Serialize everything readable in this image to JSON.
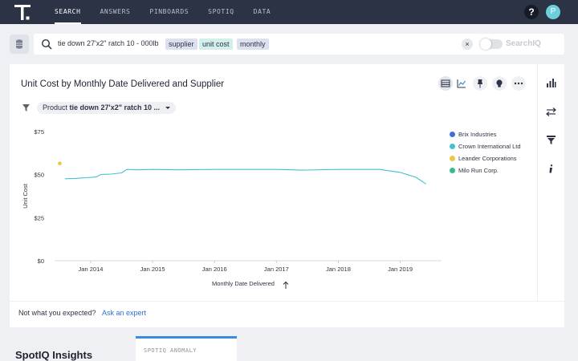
{
  "nav": {
    "logo": "thoughtspot-logo-icon",
    "items": [
      {
        "label": "SEARCH",
        "active": true
      },
      {
        "label": "ANSWERS",
        "active": false
      },
      {
        "label": "PINBOARDS",
        "active": false
      },
      {
        "label": "SPOTIQ",
        "active": false
      },
      {
        "label": "DATA",
        "active": false
      }
    ],
    "help_label": "?",
    "avatar_initial": "P"
  },
  "search": {
    "query": "tie down 27'x2\" ratch 10 - 000lb",
    "tokens": [
      "supplier",
      "unit cost",
      "monthly"
    ],
    "clear_label": "×",
    "spotiq_toggle_label": "SearchIQ",
    "spotiq_enabled": false
  },
  "answer": {
    "title": "Unit Cost by Monthly Date Delivered and Supplier",
    "toolbar_icons": [
      "table-icon",
      "chart-icon",
      "pin-icon",
      "lightbulb-icon",
      "more-icon"
    ],
    "filter": {
      "label": "Product",
      "value": "tie down 27'x2\" ratch 10 ..."
    },
    "footer_question": "Not what you expected?",
    "footer_link": "Ask an expert"
  },
  "side_tools": [
    "chart-type-icon",
    "configure-icon",
    "filter-funnel-icon",
    "info-icon"
  ],
  "chart_data": {
    "type": "line",
    "xlabel": "Monthly Date Delivered",
    "ylabel": "Unit Cost",
    "x_ticks": [
      "Jan 2014",
      "Jan 2015",
      "Jan 2016",
      "Jan 2017",
      "Jan 2018",
      "Jan 2019"
    ],
    "y_ticks": [
      "$0",
      "$25",
      "$50",
      "$75"
    ],
    "ylim": [
      0,
      75
    ],
    "xlim": [
      "2013-06",
      "2019-09"
    ],
    "grid": false,
    "legend_position": "right",
    "series": [
      {
        "name": "Brix Industries",
        "color": "#3f6fd8",
        "points": []
      },
      {
        "name": "Crown International Ltd",
        "color": "#45bfd3",
        "points": [
          {
            "x": "2013-08",
            "y": 47.6
          },
          {
            "x": "2013-10",
            "y": 47.8
          },
          {
            "x": "2013-12",
            "y": 48.2
          },
          {
            "x": "2014-02",
            "y": 48.6
          },
          {
            "x": "2014-03",
            "y": 50.1
          },
          {
            "x": "2014-05",
            "y": 50.3
          },
          {
            "x": "2014-07",
            "y": 51.0
          },
          {
            "x": "2014-08",
            "y": 53.0
          },
          {
            "x": "2014-10",
            "y": 52.8
          },
          {
            "x": "2015-01",
            "y": 53.0
          },
          {
            "x": "2015-06",
            "y": 52.8
          },
          {
            "x": "2016-01",
            "y": 53.0
          },
          {
            "x": "2017-01",
            "y": 53.0
          },
          {
            "x": "2017-06",
            "y": 52.6
          },
          {
            "x": "2018-01",
            "y": 53.0
          },
          {
            "x": "2018-09",
            "y": 53.0
          },
          {
            "x": "2019-01",
            "y": 51.3
          },
          {
            "x": "2019-04",
            "y": 48.5
          },
          {
            "x": "2019-06",
            "y": 44.6
          }
        ]
      },
      {
        "name": "Leander Corporations",
        "color": "#ecc84a",
        "points": [
          {
            "x": "2013-07",
            "y": 56.5
          }
        ]
      },
      {
        "name": "Milo Run Corp.",
        "color": "#2fbf8c",
        "points": []
      }
    ]
  },
  "spotiq": {
    "title": "SpotIQ Insights",
    "anomaly_label": "SPOTIQ ANOMALY"
  }
}
